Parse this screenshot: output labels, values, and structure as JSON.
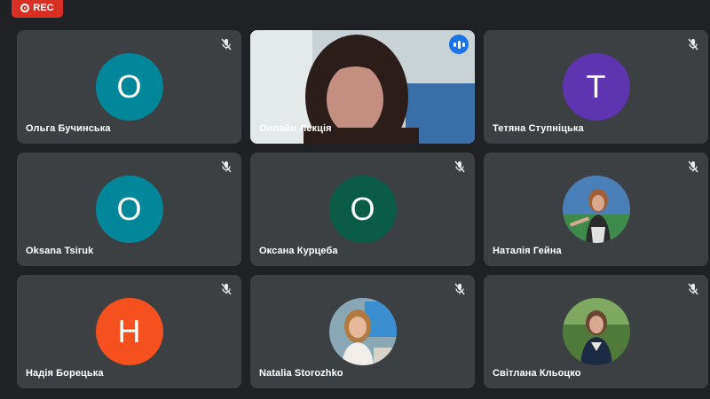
{
  "recording": {
    "label": "REC",
    "color": "#d93025"
  },
  "tiles": [
    {
      "name": "Ольга Бучинська",
      "type": "initial",
      "initial": "O",
      "color": "#00879a",
      "muted": true
    },
    {
      "name": "Онлайн Лекція",
      "type": "video",
      "speaking": true
    },
    {
      "name": "Тетяна Ступніцька",
      "type": "initial",
      "initial": "T",
      "color": "#5e35b1",
      "muted": true
    },
    {
      "name": "Oksana Tsiruk",
      "type": "initial",
      "initial": "O",
      "color": "#00879a",
      "muted": true
    },
    {
      "name": "Оксана Курцеба",
      "type": "initial",
      "initial": "O",
      "color": "#0a5c47",
      "muted": true
    },
    {
      "name": "Наталія Гейна",
      "type": "photo",
      "muted": true
    },
    {
      "name": "Надія Борецька",
      "type": "initial",
      "initial": "H",
      "color": "#f4511e",
      "muted": true
    },
    {
      "name": "Natalia Storozhko",
      "type": "photo",
      "muted": true
    },
    {
      "name": "Світлана Кльоцко",
      "type": "photo",
      "muted": true
    }
  ]
}
